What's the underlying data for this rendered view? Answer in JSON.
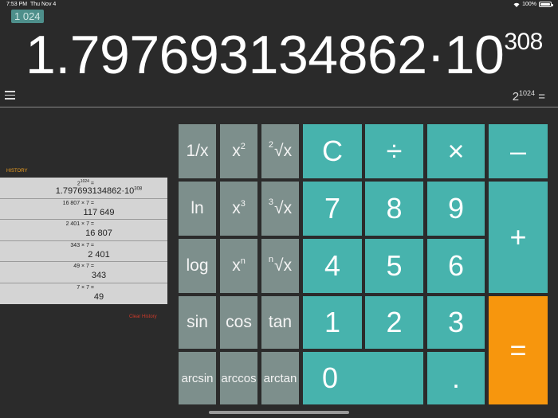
{
  "status_bar": {
    "time": "7:53 PM",
    "date": "Thu Nov 4",
    "battery": "100%"
  },
  "display": {
    "memory_badge": "1 024",
    "value_mantissa": "1.797693134862·10",
    "value_exponent": "308",
    "expression_base": "2",
    "expression_exponent": "1024",
    "expression_suffix": " ="
  },
  "history": {
    "label": "HISTORY",
    "entries": [
      {
        "expr_base": "2",
        "expr_exp": "1024",
        "expr_tail": " =",
        "result_main": "1.797693134862·10",
        "result_exp": "308"
      },
      {
        "expr_base": "16 807 × 7 =",
        "expr_exp": "",
        "expr_tail": "",
        "result_main": "117 649",
        "result_exp": ""
      },
      {
        "expr_base": "2 401 × 7 =",
        "expr_exp": "",
        "expr_tail": "",
        "result_main": "16 807",
        "result_exp": ""
      },
      {
        "expr_base": "343 × 7 =",
        "expr_exp": "",
        "expr_tail": "",
        "result_main": "2 401",
        "result_exp": ""
      },
      {
        "expr_base": "49 × 7 =",
        "expr_exp": "",
        "expr_tail": "",
        "result_main": "343",
        "result_exp": ""
      },
      {
        "expr_base": "7 × 7 =",
        "expr_exp": "",
        "expr_tail": "",
        "result_main": "49",
        "result_exp": ""
      }
    ],
    "clear_label": "Clear History"
  },
  "keypad": {
    "reciprocal": "1/x",
    "square_base": "x",
    "square_exp": "2",
    "sqrt_index": "2",
    "sqrt_rest": "√x",
    "ln": "ln",
    "cube_base": "x",
    "cube_exp": "3",
    "cbrt_index": "3",
    "cbrt_rest": "√x",
    "log": "log",
    "pow_base": "x",
    "pow_exp": "n",
    "nroot_index": "n",
    "nroot_rest": "√x",
    "sin": "sin",
    "cos": "cos",
    "tan": "tan",
    "arcsin": "arcsin",
    "arccos": "arccos",
    "arctan": "arctan",
    "clear": "C",
    "divide": "÷",
    "multiply": "×",
    "minus": "–",
    "plus": "+",
    "equals": "=",
    "d7": "7",
    "d8": "8",
    "d9": "9",
    "d4": "4",
    "d5": "5",
    "d6": "6",
    "d1": "1",
    "d2": "2",
    "d3": "3",
    "d0": "0",
    "decimal": "."
  },
  "colors": {
    "function_key": "#7d8f8c",
    "number_key": "#47b3ad",
    "equals_key": "#f7960d",
    "history_label": "#f0a020",
    "clear_history": "#d03a2a"
  }
}
